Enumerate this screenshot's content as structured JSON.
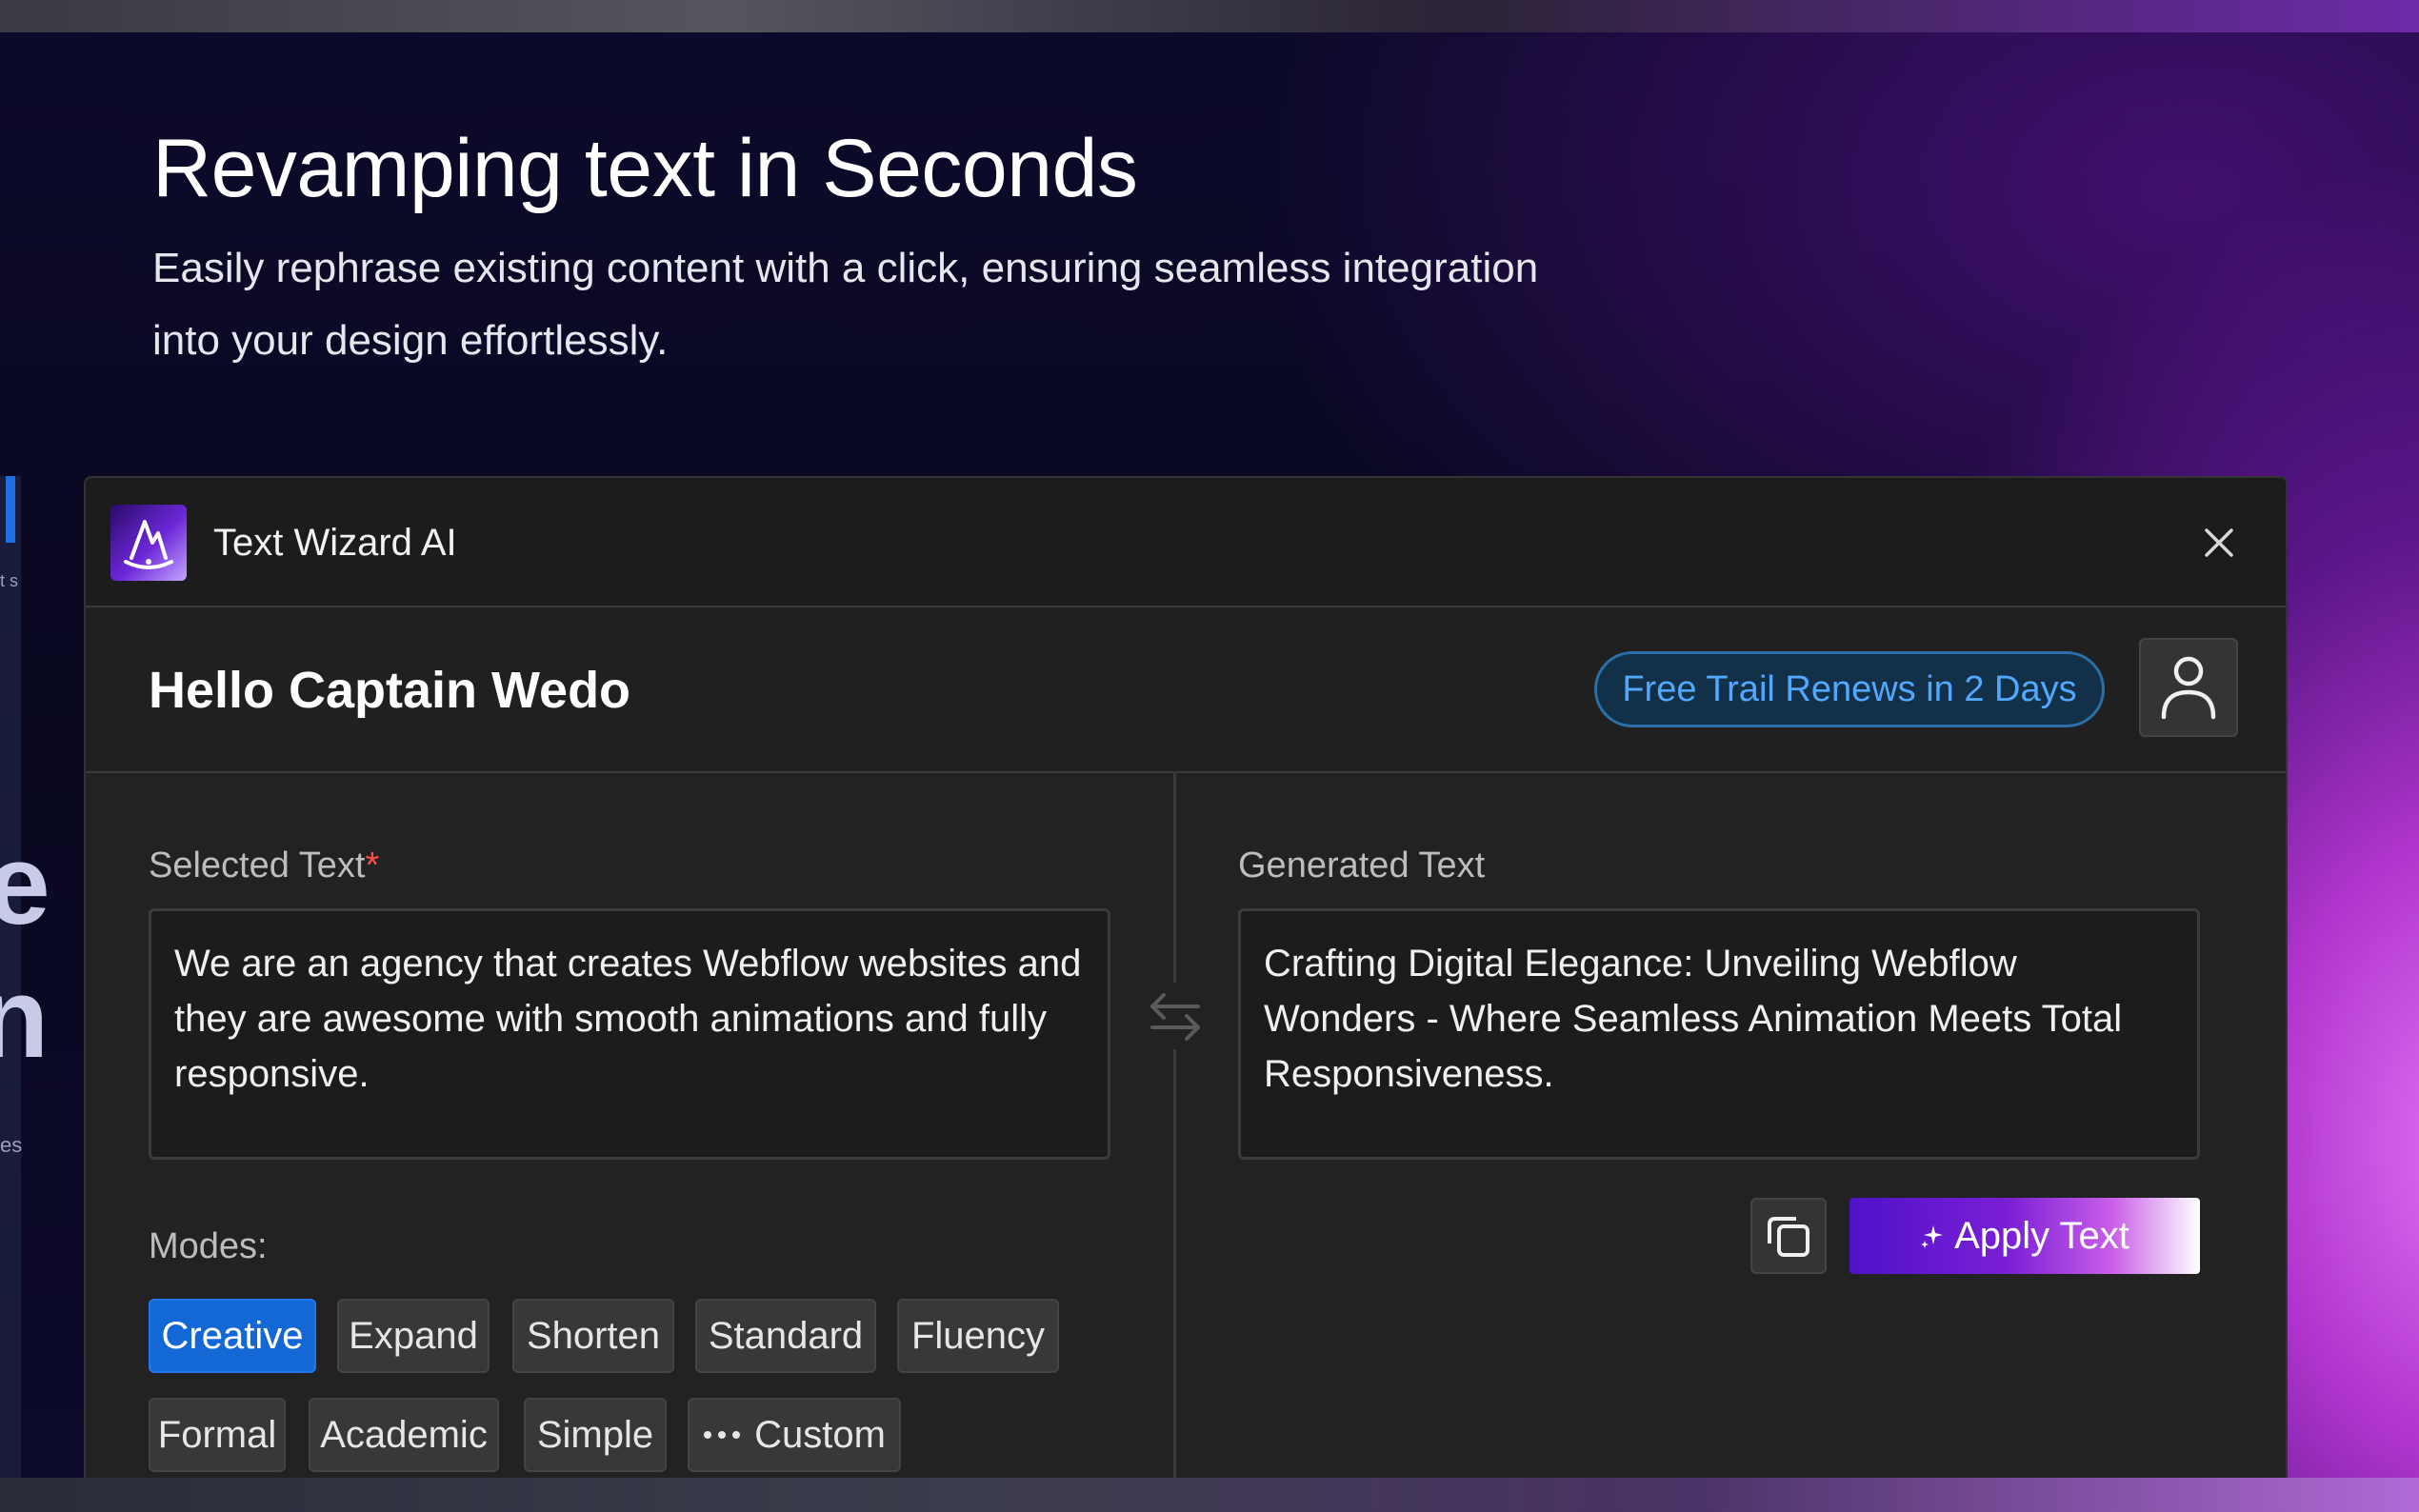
{
  "hero": {
    "title": "Revamping text in Seconds",
    "subtitle_line1": "Easily rephrase existing content with a click, ensuring seamless integration",
    "subtitle_line2": "into your design effortlessly."
  },
  "background_fragments": {
    "frag1": "t s",
    "frag2": "e",
    "frag3": "n",
    "frag4": "es"
  },
  "app": {
    "title": "Text Wizard AI",
    "logo_icon": "wizard-hat-icon",
    "close_icon": "close-icon"
  },
  "user": {
    "greeting": "Hello Captain Wedo",
    "trial_badge": "Free Trail Renews in 2 Days",
    "avatar_icon": "user-icon"
  },
  "selected": {
    "label": "Selected Text",
    "required_mark": "*",
    "value": "We are an agency that creates Webflow websites and they are awesome with smooth animations and fully responsive."
  },
  "generated": {
    "label": "Generated Text",
    "value": "Crafting Digital Elegance: Unveiling Webflow Wonders - Where Seamless Animation Meets Total Responsiveness."
  },
  "modes": {
    "label": "Modes:",
    "items": [
      {
        "label": "Creative",
        "active": true
      },
      {
        "label": "Expand",
        "active": false
      },
      {
        "label": "Shorten",
        "active": false
      },
      {
        "label": "Standard",
        "active": false
      },
      {
        "label": "Fluency",
        "active": false
      },
      {
        "label": "Formal",
        "active": false
      },
      {
        "label": "Academic",
        "active": false
      },
      {
        "label": "Simple",
        "active": false
      },
      {
        "label": "Custom",
        "active": false,
        "icon": "more-dots-icon"
      }
    ]
  },
  "actions": {
    "copy_icon": "copy-icon",
    "apply_label": "Apply Text",
    "apply_icon": "sparkle-icon"
  },
  "colors": {
    "accent_blue": "#1468d6",
    "trial_text": "#52a8ff",
    "panel_bg": "#222222",
    "apply_gradient_start": "#4f12c8"
  }
}
